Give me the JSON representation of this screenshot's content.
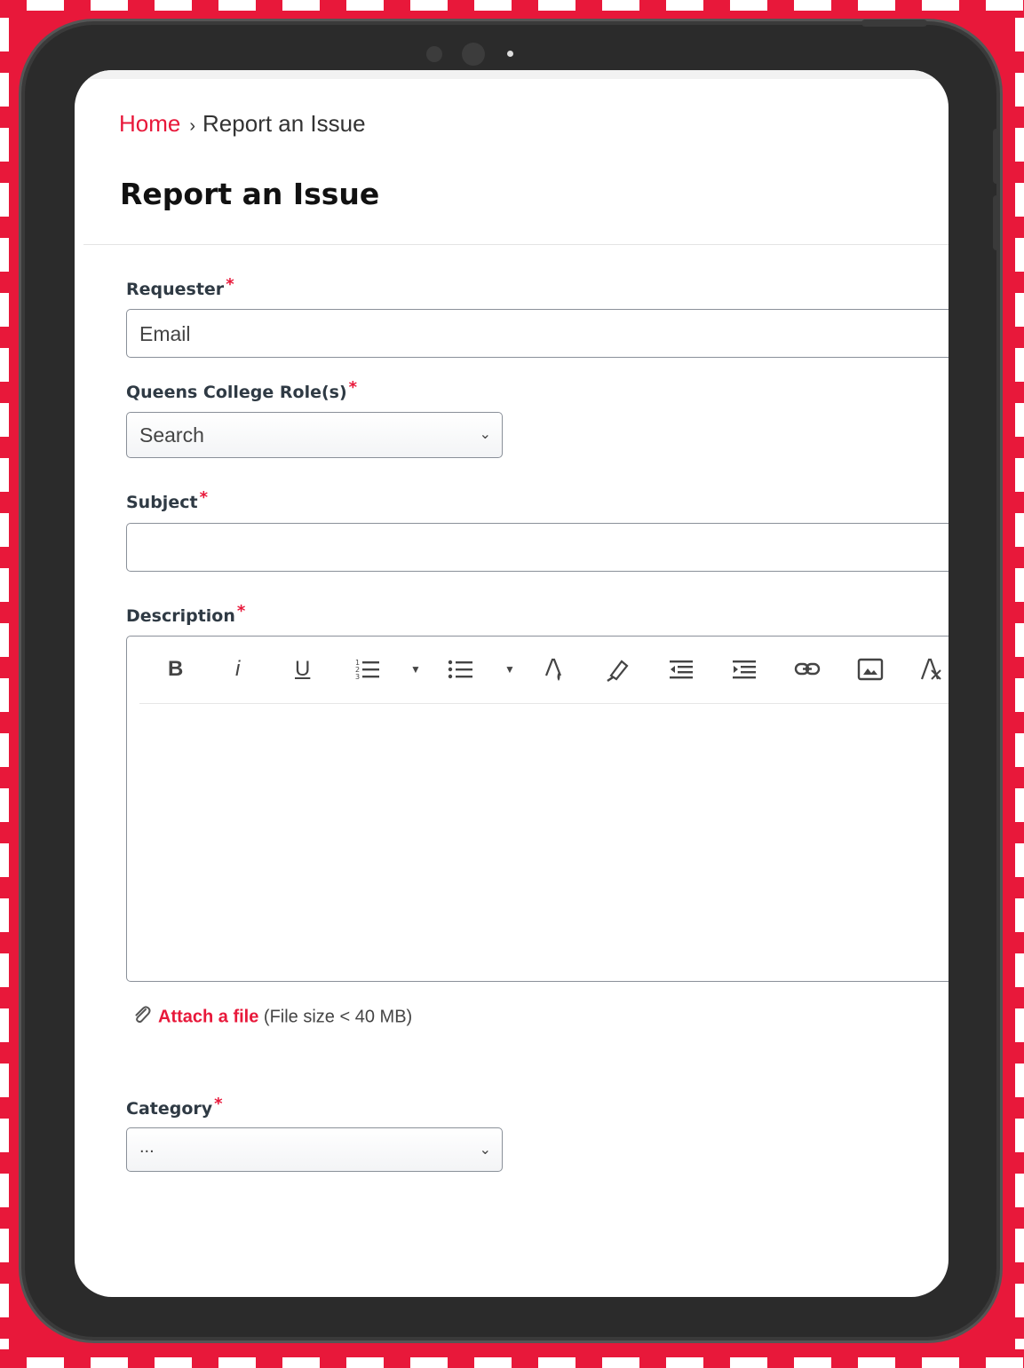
{
  "breadcrumb": {
    "home": "Home",
    "separator": "›",
    "current": "Report an Issue"
  },
  "page": {
    "title": "Report an Issue"
  },
  "form": {
    "requester": {
      "label": "Requester",
      "required_mark": "*",
      "value": "Email"
    },
    "role": {
      "label": "Queens College Role(s)",
      "required_mark": "*",
      "value": "Search"
    },
    "subject": {
      "label": "Subject",
      "required_mark": "*",
      "value": ""
    },
    "description": {
      "label": "Description",
      "required_mark": "*",
      "toolbar": [
        "bold-icon",
        "italic-icon",
        "underline-icon",
        "ordered-list-icon",
        "unordered-list-icon",
        "font-color-icon",
        "highlight-icon",
        "outdent-icon",
        "indent-icon",
        "link-icon",
        "image-icon",
        "clear-format-icon"
      ],
      "bold": "B",
      "italic": "i",
      "underline": "U"
    },
    "attach": {
      "link": "Attach a file",
      "note": "(File size < 40 MB)"
    },
    "category": {
      "label": "Category",
      "required_mark": "*",
      "value": "..."
    }
  },
  "colors": {
    "accent": "#e8183a",
    "tablet": "#2b2b2b"
  }
}
